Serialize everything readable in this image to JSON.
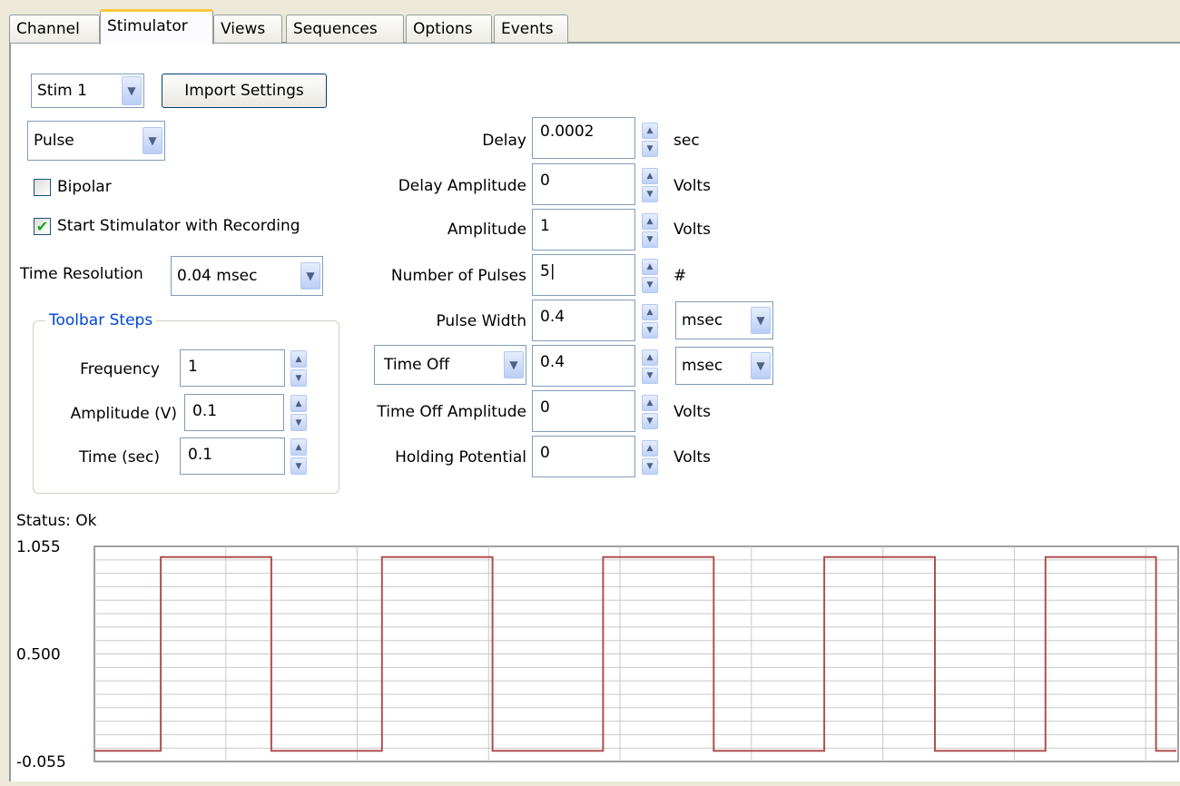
{
  "tabs": [
    {
      "label": "Channel",
      "active": false
    },
    {
      "label": "Stimulator",
      "active": true
    },
    {
      "label": "Views",
      "active": false
    },
    {
      "label": "Sequences",
      "active": false
    },
    {
      "label": "Options",
      "active": false
    },
    {
      "label": "Events",
      "active": false
    }
  ],
  "stim_select": {
    "value": "Stim 1"
  },
  "import_button": {
    "label": "Import Settings"
  },
  "waveform_select": {
    "value": "Pulse"
  },
  "bipolar": {
    "label": "Bipolar",
    "checked": false
  },
  "start_with_recording": {
    "label": "Start Stimulator with Recording",
    "checked": true,
    "checkmark": "✔"
  },
  "time_resolution": {
    "label": "Time Resolution",
    "value": "0.04 msec"
  },
  "toolbar_steps": {
    "title": "Toolbar Steps",
    "frequency": {
      "label": "Frequency",
      "value": "1"
    },
    "amplitude": {
      "label": "Amplitude (V)",
      "value": "0.1"
    },
    "time": {
      "label": "Time (sec)",
      "value": "0.1"
    }
  },
  "params": {
    "delay": {
      "label": "Delay",
      "value": "0.0002",
      "unit": "sec"
    },
    "delay_amplitude": {
      "label": "Delay Amplitude",
      "value": "0",
      "unit": "Volts"
    },
    "amplitude": {
      "label": "Amplitude",
      "value": "1",
      "unit": "Volts"
    },
    "number_of_pulses": {
      "label": "Number of Pulses",
      "value": "5|",
      "unit": "#"
    },
    "pulse_width": {
      "label": "Pulse Width",
      "value": "0.4",
      "unit": "msec"
    },
    "time_off": {
      "label": "Time Off",
      "value": "0.4",
      "unit": "msec"
    },
    "time_off_amplitude": {
      "label": "Time Off Amplitude",
      "value": "0",
      "unit": "Volts"
    },
    "holding_potential": {
      "label": "Holding Potential",
      "value": "0",
      "unit": "Volts"
    }
  },
  "status": {
    "text": "Status: Ok"
  },
  "icons": {
    "down": "▼",
    "up": "▲"
  },
  "colors": {
    "trace": "#b05050",
    "grid": "#c8c8c8",
    "tab_accent": "#ffc83c"
  },
  "chart_data": {
    "type": "line",
    "yticks": [
      "1.055",
      "0.500",
      "-0.055"
    ],
    "ylim": [
      -0.055,
      1.055
    ],
    "x": [
      0,
      0.6,
      0.6,
      1.6,
      1.6,
      2.6,
      2.6,
      3.6,
      3.6,
      4.6,
      4.6,
      5.6,
      5.6,
      6.6,
      6.6,
      7.6,
      7.6,
      8.6,
      8.6,
      9.6,
      9.6,
      10.0
    ],
    "y": [
      0,
      0,
      1,
      1,
      0,
      0,
      1,
      1,
      0,
      0,
      1,
      1,
      0,
      0,
      1,
      1,
      0,
      0,
      1,
      1,
      0,
      0
    ],
    "xlim": [
      0,
      9.8
    ],
    "grid": true
  }
}
